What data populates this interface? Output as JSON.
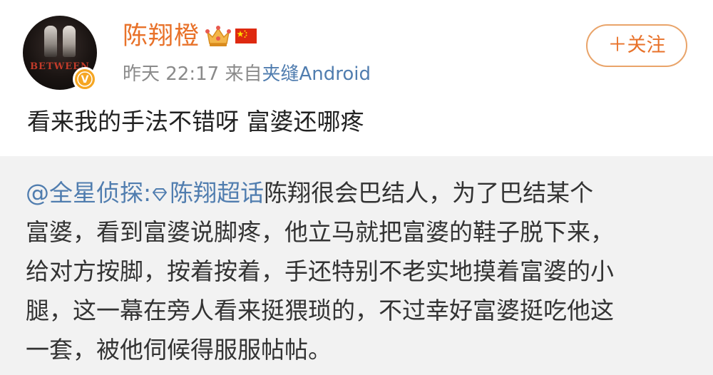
{
  "user": {
    "name": "陈翔橙",
    "avatar_text": "BETWEEN",
    "badges": [
      "crown-icon",
      "china-flag-icon"
    ],
    "verify_badge": "V"
  },
  "meta": {
    "time": "昨天 22:17",
    "from_prefix": "来自",
    "source": "夹缝",
    "device": "Android"
  },
  "follow_button": "＋关注",
  "post": {
    "text": "看来我的手法不错呀  富婆还哪疼"
  },
  "repost": {
    "mention": "@全星侦探:",
    "topic": "陈翔超话",
    "lines": [
      "陈翔很会巴结人，为了巴结某个",
      "富婆，看到富婆说脚疼，他立马就把富婆的鞋子脱下来，",
      "给对方按脚，按着按着，手还特别不老实地摸着富婆的小",
      "腿，这一幕在旁人看来挺猥琐的，不过幸好富婆挺吃他这",
      "一套，被他伺候得服服帖帖。"
    ]
  },
  "colors": {
    "name": "#e8722a",
    "link": "#507daf",
    "meta": "#8a8a8a",
    "repost_bg": "#f2f2f2",
    "badge": "#f5a623"
  }
}
